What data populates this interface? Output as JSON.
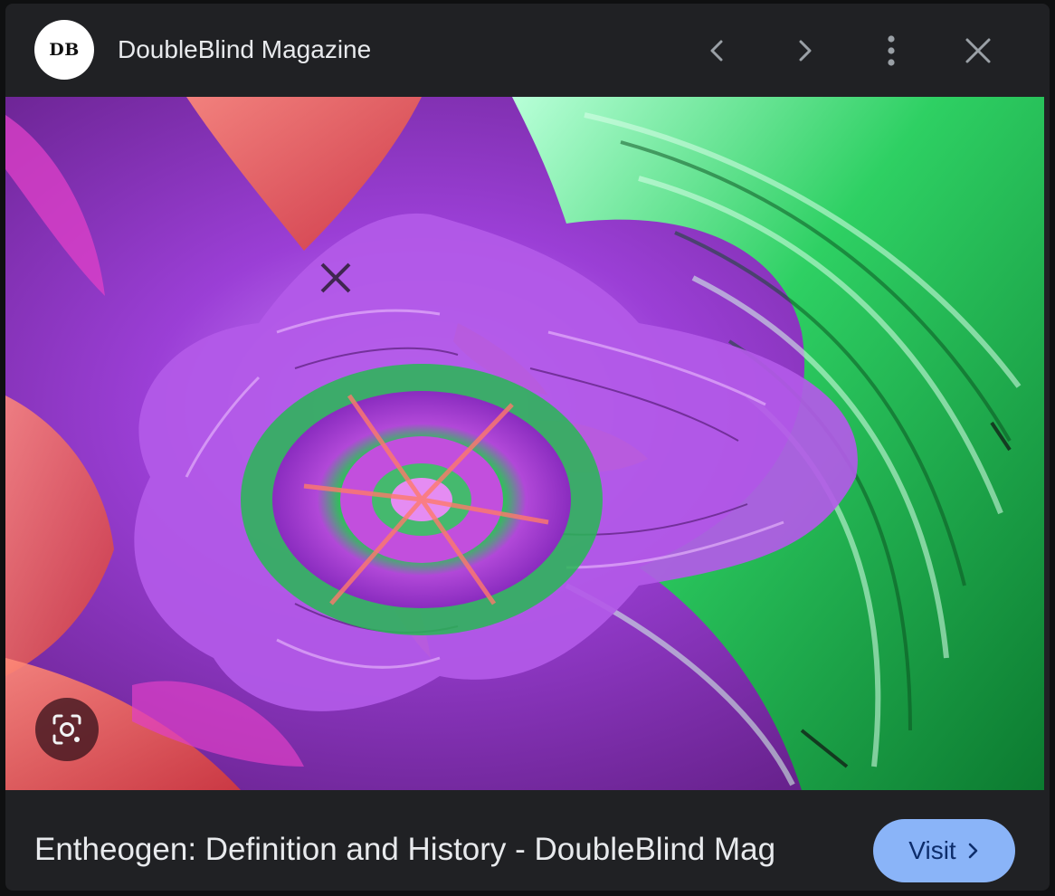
{
  "header": {
    "logo_text": "DB",
    "source_name": "DoubleBlind Magazine",
    "prev_icon": "chevron-left-icon",
    "next_icon": "chevron-right-icon",
    "more_icon": "more-vert-icon",
    "close_icon": "close-icon"
  },
  "image": {
    "description_colors": {
      "green": "#1fbf55",
      "purple": "#b35ae8",
      "coral": "#f0605a",
      "magenta": "#e040c8"
    }
  },
  "lens": {
    "icon": "lens-search-icon"
  },
  "footer": {
    "title": "Entheogen: Definition and History - DoubleBlind Mag",
    "visit_label": "Visit",
    "visit_icon": "chevron-right-icon"
  },
  "colors": {
    "panel_bg": "#202124",
    "text": "#e8eaed",
    "accent": "#8ab4f8",
    "accent_text": "#0d2d6b"
  }
}
